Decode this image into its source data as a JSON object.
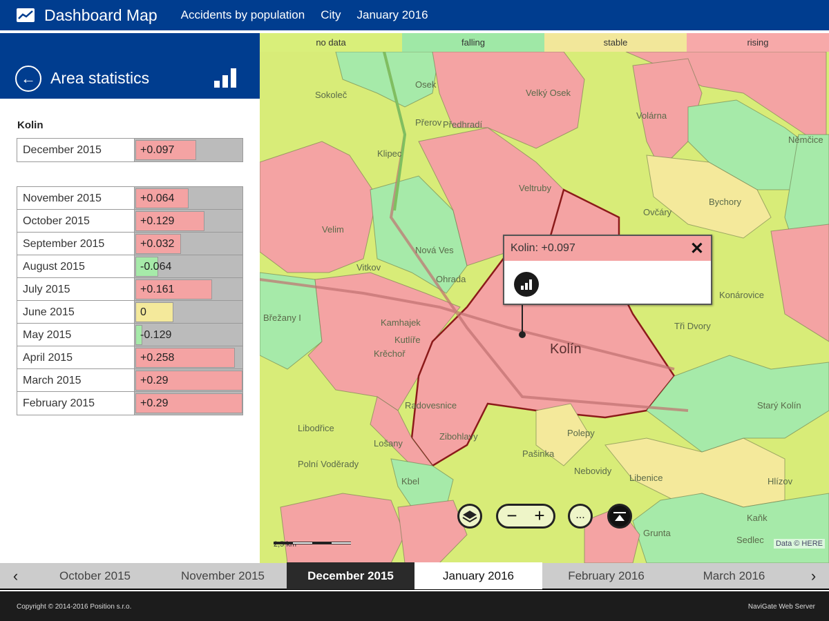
{
  "header": {
    "title": "Dashboard Map",
    "icon": "chart-line-icon",
    "crumbs": [
      "Accidents by population",
      "City",
      "January 2016"
    ]
  },
  "panel": {
    "title": "Area statistics",
    "back_icon": "arrow-left-circle-icon",
    "stats_icon": "bar-chart-icon",
    "area": "Kolin",
    "current": {
      "month": "December 2015",
      "value": 0.097,
      "label": "+0.097",
      "status": "rising"
    },
    "history": [
      {
        "month": "November 2015",
        "value": 0.064,
        "label": "+0.064",
        "status": "rising"
      },
      {
        "month": "October 2015",
        "value": 0.129,
        "label": "+0.129",
        "status": "rising"
      },
      {
        "month": "September 2015",
        "value": 0.032,
        "label": "+0.032",
        "status": "rising"
      },
      {
        "month": "August 2015",
        "value": -0.064,
        "label": "-0.064",
        "status": "falling"
      },
      {
        "month": "July 2015",
        "value": 0.161,
        "label": "+0.161",
        "status": "rising"
      },
      {
        "month": "June 2015",
        "value": 0,
        "label": "0",
        "status": "stable"
      },
      {
        "month": "May 2015",
        "value": -0.129,
        "label": "-0.129",
        "status": "falling"
      },
      {
        "month": "April 2015",
        "value": 0.258,
        "label": "+0.258",
        "status": "rising"
      },
      {
        "month": "March 2015",
        "value": 0.29,
        "label": "+0.29",
        "status": "rising"
      },
      {
        "month": "February 2015",
        "value": 0.29,
        "label": "+0.29",
        "status": "rising"
      }
    ]
  },
  "legend": [
    {
      "label": "no data",
      "color": "#d9ef7a"
    },
    {
      "label": "falling",
      "color": "#9fe8a6"
    },
    {
      "label": "stable",
      "color": "#f2e79a"
    },
    {
      "label": "rising",
      "color": "#f7a9a9"
    }
  ],
  "colors": {
    "rising": "#f4a3a3",
    "falling": "#a6eaa9",
    "stable": "#f4e99b",
    "nodata": "#d8ec78",
    "brand": "#003d8f"
  },
  "map": {
    "places": [
      "Sokoleč",
      "Osek",
      "Velký Osek",
      "Volárna",
      "Přerov",
      "Předhradí",
      "Klipec",
      "Veltruby",
      "Ovčáry",
      "Bychory",
      "Němčice",
      "Velim",
      "Nová Ves",
      "Ohrada",
      "Vitkov",
      "Břežany I",
      "Kamhajek",
      "Kutlíře",
      "Krěchoř",
      "Kolín",
      "Tři Dvory",
      "Konárovice",
      "Radovesnice",
      "Libenice",
      "Polní Voděrady",
      "Kbel",
      "Starý Kolín",
      "Hlízov",
      "Nebovidy",
      "Polepy",
      "Pašinka",
      "Grunta",
      "Zibohlavy",
      "Libodřice",
      "Lošany",
      "Sedlec",
      "Kaňk"
    ],
    "popup": {
      "title": "Kolin: +0.097",
      "close_icon": "close-icon",
      "stats_icon": "bar-chart-icon"
    },
    "scale": "2,5 km",
    "attribution": "Data © HERE",
    "controls": {
      "layers_icon": "layers-icon",
      "zoom_out": "−",
      "zoom_in": "+",
      "more": "...",
      "locate_icon": "locate-icon"
    }
  },
  "timeline": {
    "prev_icon": "chevron-left-icon",
    "next_icon": "chevron-right-icon",
    "months": [
      "October 2015",
      "November 2015",
      "December 2015",
      "January 2016",
      "February 2016",
      "March 2016"
    ],
    "selected": "December 2015",
    "current": "January 2016"
  },
  "footer": {
    "copyright": "Copyright © 2014-2016 Position s.r.o.",
    "product": "NaviGate Web Server"
  }
}
